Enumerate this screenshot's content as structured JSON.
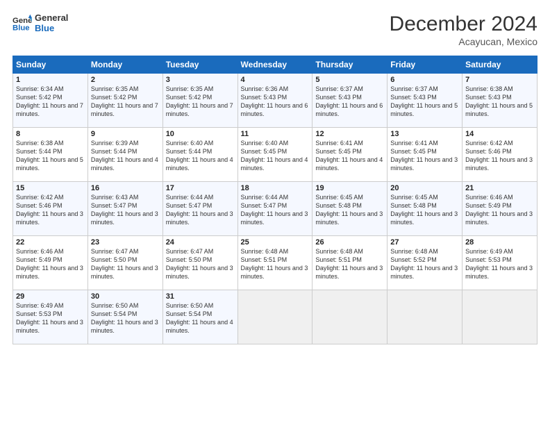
{
  "header": {
    "logo_line1": "General",
    "logo_line2": "Blue",
    "month": "December 2024",
    "location": "Acayucan, Mexico"
  },
  "days_of_week": [
    "Sunday",
    "Monday",
    "Tuesday",
    "Wednesday",
    "Thursday",
    "Friday",
    "Saturday"
  ],
  "weeks": [
    [
      {
        "day": "1",
        "sunrise": "Sunrise: 6:34 AM",
        "sunset": "Sunset: 5:42 PM",
        "daylight": "Daylight: 11 hours and 7 minutes."
      },
      {
        "day": "2",
        "sunrise": "Sunrise: 6:35 AM",
        "sunset": "Sunset: 5:42 PM",
        "daylight": "Daylight: 11 hours and 7 minutes."
      },
      {
        "day": "3",
        "sunrise": "Sunrise: 6:35 AM",
        "sunset": "Sunset: 5:42 PM",
        "daylight": "Daylight: 11 hours and 7 minutes."
      },
      {
        "day": "4",
        "sunrise": "Sunrise: 6:36 AM",
        "sunset": "Sunset: 5:43 PM",
        "daylight": "Daylight: 11 hours and 6 minutes."
      },
      {
        "day": "5",
        "sunrise": "Sunrise: 6:37 AM",
        "sunset": "Sunset: 5:43 PM",
        "daylight": "Daylight: 11 hours and 6 minutes."
      },
      {
        "day": "6",
        "sunrise": "Sunrise: 6:37 AM",
        "sunset": "Sunset: 5:43 PM",
        "daylight": "Daylight: 11 hours and 5 minutes."
      },
      {
        "day": "7",
        "sunrise": "Sunrise: 6:38 AM",
        "sunset": "Sunset: 5:43 PM",
        "daylight": "Daylight: 11 hours and 5 minutes."
      }
    ],
    [
      {
        "day": "8",
        "sunrise": "Sunrise: 6:38 AM",
        "sunset": "Sunset: 5:44 PM",
        "daylight": "Daylight: 11 hours and 5 minutes."
      },
      {
        "day": "9",
        "sunrise": "Sunrise: 6:39 AM",
        "sunset": "Sunset: 5:44 PM",
        "daylight": "Daylight: 11 hours and 4 minutes."
      },
      {
        "day": "10",
        "sunrise": "Sunrise: 6:40 AM",
        "sunset": "Sunset: 5:44 PM",
        "daylight": "Daylight: 11 hours and 4 minutes."
      },
      {
        "day": "11",
        "sunrise": "Sunrise: 6:40 AM",
        "sunset": "Sunset: 5:45 PM",
        "daylight": "Daylight: 11 hours and 4 minutes."
      },
      {
        "day": "12",
        "sunrise": "Sunrise: 6:41 AM",
        "sunset": "Sunset: 5:45 PM",
        "daylight": "Daylight: 11 hours and 4 minutes."
      },
      {
        "day": "13",
        "sunrise": "Sunrise: 6:41 AM",
        "sunset": "Sunset: 5:45 PM",
        "daylight": "Daylight: 11 hours and 3 minutes."
      },
      {
        "day": "14",
        "sunrise": "Sunrise: 6:42 AM",
        "sunset": "Sunset: 5:46 PM",
        "daylight": "Daylight: 11 hours and 3 minutes."
      }
    ],
    [
      {
        "day": "15",
        "sunrise": "Sunrise: 6:42 AM",
        "sunset": "Sunset: 5:46 PM",
        "daylight": "Daylight: 11 hours and 3 minutes."
      },
      {
        "day": "16",
        "sunrise": "Sunrise: 6:43 AM",
        "sunset": "Sunset: 5:47 PM",
        "daylight": "Daylight: 11 hours and 3 minutes."
      },
      {
        "day": "17",
        "sunrise": "Sunrise: 6:44 AM",
        "sunset": "Sunset: 5:47 PM",
        "daylight": "Daylight: 11 hours and 3 minutes."
      },
      {
        "day": "18",
        "sunrise": "Sunrise: 6:44 AM",
        "sunset": "Sunset: 5:47 PM",
        "daylight": "Daylight: 11 hours and 3 minutes."
      },
      {
        "day": "19",
        "sunrise": "Sunrise: 6:45 AM",
        "sunset": "Sunset: 5:48 PM",
        "daylight": "Daylight: 11 hours and 3 minutes."
      },
      {
        "day": "20",
        "sunrise": "Sunrise: 6:45 AM",
        "sunset": "Sunset: 5:48 PM",
        "daylight": "Daylight: 11 hours and 3 minutes."
      },
      {
        "day": "21",
        "sunrise": "Sunrise: 6:46 AM",
        "sunset": "Sunset: 5:49 PM",
        "daylight": "Daylight: 11 hours and 3 minutes."
      }
    ],
    [
      {
        "day": "22",
        "sunrise": "Sunrise: 6:46 AM",
        "sunset": "Sunset: 5:49 PM",
        "daylight": "Daylight: 11 hours and 3 minutes."
      },
      {
        "day": "23",
        "sunrise": "Sunrise: 6:47 AM",
        "sunset": "Sunset: 5:50 PM",
        "daylight": "Daylight: 11 hours and 3 minutes."
      },
      {
        "day": "24",
        "sunrise": "Sunrise: 6:47 AM",
        "sunset": "Sunset: 5:50 PM",
        "daylight": "Daylight: 11 hours and 3 minutes."
      },
      {
        "day": "25",
        "sunrise": "Sunrise: 6:48 AM",
        "sunset": "Sunset: 5:51 PM",
        "daylight": "Daylight: 11 hours and 3 minutes."
      },
      {
        "day": "26",
        "sunrise": "Sunrise: 6:48 AM",
        "sunset": "Sunset: 5:51 PM",
        "daylight": "Daylight: 11 hours and 3 minutes."
      },
      {
        "day": "27",
        "sunrise": "Sunrise: 6:48 AM",
        "sunset": "Sunset: 5:52 PM",
        "daylight": "Daylight: 11 hours and 3 minutes."
      },
      {
        "day": "28",
        "sunrise": "Sunrise: 6:49 AM",
        "sunset": "Sunset: 5:53 PM",
        "daylight": "Daylight: 11 hours and 3 minutes."
      }
    ],
    [
      {
        "day": "29",
        "sunrise": "Sunrise: 6:49 AM",
        "sunset": "Sunset: 5:53 PM",
        "daylight": "Daylight: 11 hours and 3 minutes."
      },
      {
        "day": "30",
        "sunrise": "Sunrise: 6:50 AM",
        "sunset": "Sunset: 5:54 PM",
        "daylight": "Daylight: 11 hours and 3 minutes."
      },
      {
        "day": "31",
        "sunrise": "Sunrise: 6:50 AM",
        "sunset": "Sunset: 5:54 PM",
        "daylight": "Daylight: 11 hours and 4 minutes."
      },
      {
        "day": "",
        "sunrise": "",
        "sunset": "",
        "daylight": ""
      },
      {
        "day": "",
        "sunrise": "",
        "sunset": "",
        "daylight": ""
      },
      {
        "day": "",
        "sunrise": "",
        "sunset": "",
        "daylight": ""
      },
      {
        "day": "",
        "sunrise": "",
        "sunset": "",
        "daylight": ""
      }
    ]
  ]
}
